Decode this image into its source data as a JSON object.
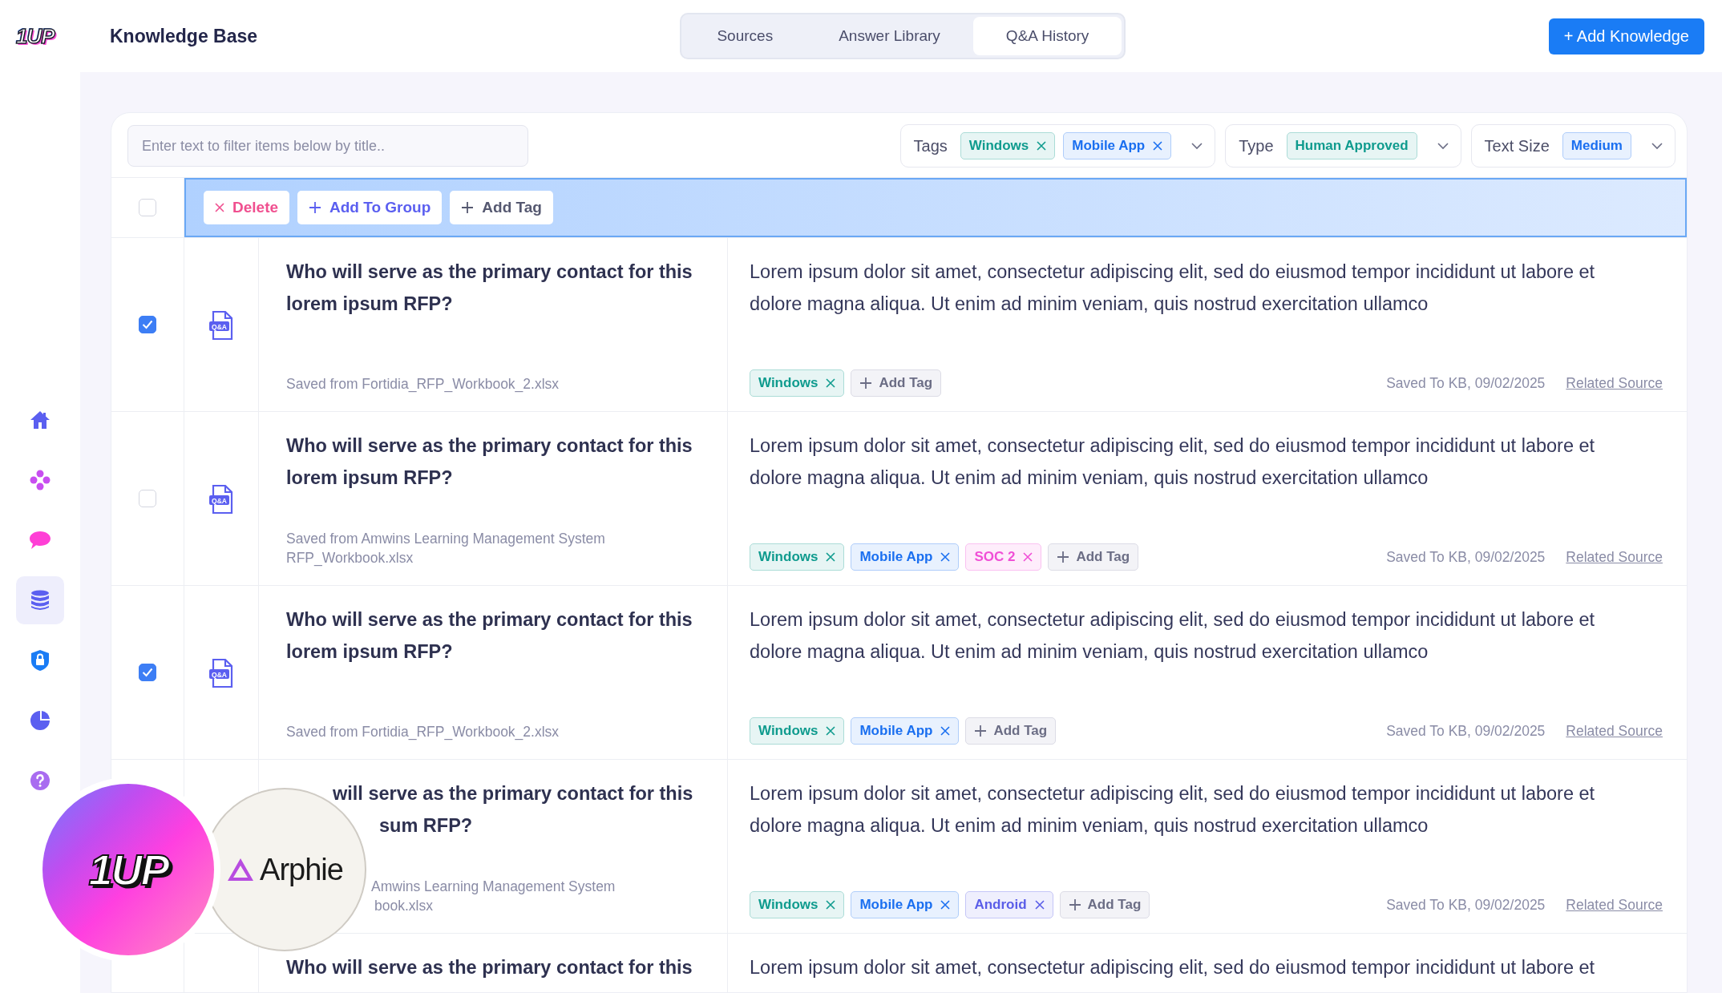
{
  "header": {
    "logo": "1UP",
    "title": "Knowledge Base",
    "tabs": [
      {
        "label": "Sources",
        "selected": false
      },
      {
        "label": "Answer Library",
        "selected": false
      },
      {
        "label": "Q&A History",
        "selected": true
      }
    ],
    "add_button": "+ Add Knowledge"
  },
  "sidebar": {
    "items": [
      {
        "selected": false
      },
      {
        "selected": false
      },
      {
        "selected": false
      },
      {
        "selected": true
      },
      {
        "selected": false
      },
      {
        "selected": false
      },
      {
        "selected": false
      }
    ]
  },
  "filters": {
    "search_placeholder": "Enter text to filter items below by title..",
    "groups": [
      {
        "label": "Tags",
        "chips": [
          {
            "label": "Windows",
            "color": "#0f9b8e"
          },
          {
            "label": "Mobile App",
            "color": "#1a6ff0"
          }
        ]
      },
      {
        "label": "Type",
        "chips": [
          {
            "label": "Human Approved",
            "color": "#0f9b8e"
          }
        ]
      },
      {
        "label": "Text Size",
        "chips": [
          {
            "label": "Medium",
            "color": "#1a6ff0"
          }
        ]
      }
    ]
  },
  "bulk_actions": {
    "all_checked": false,
    "buttons": [
      {
        "kind": "delete",
        "label": "Delete"
      },
      {
        "kind": "group",
        "label": "Add To Group"
      },
      {
        "kind": "tag",
        "label": "Add Tag"
      }
    ]
  },
  "rows": [
    {
      "kind": "full",
      "checked": true,
      "file_badge": "Q&A",
      "question": "Who will serve as the primary contact for this lorem ipsum RFP?",
      "source": "Saved from Fortidia_RFP_Workbook_2.xlsx",
      "answer": "Lorem ipsum dolor sit amet, consectetur adipiscing elit, sed do eiusmod tempor incididunt ut labore et dolore magna aliqua. Ut enim ad minim veniam, quis nostrud exercitation ullamco",
      "tags": [
        {
          "label": "Windows",
          "color": "#0f9b8e"
        }
      ],
      "add_tag": "Add Tag",
      "saved": "Saved To KB, 09/02/2025",
      "link": "Related Source"
    },
    {
      "kind": "full",
      "checked": false,
      "file_badge": "Q&A",
      "question": "Who will serve as the primary contact for this lorem ipsum RFP?",
      "source": "Saved from Amwins Learning Management System RFP_Workbook.xlsx",
      "answer": "Lorem ipsum dolor sit amet, consectetur adipiscing elit, sed do eiusmod tempor incididunt ut labore et dolore magna aliqua. Ut enim ad minim veniam, quis nostrud exercitation ullamco",
      "tags": [
        {
          "label": "Windows",
          "color": "#0f9b8e"
        },
        {
          "label": "Mobile App",
          "color": "#1a6ff0"
        },
        {
          "label": "SOC 2",
          "color": "#f04fd6"
        }
      ],
      "add_tag": "Add Tag",
      "saved": "Saved To KB, 09/02/2025",
      "link": "Related Source"
    },
    {
      "kind": "full",
      "checked": true,
      "file_badge": "Q&A",
      "question": "Who will serve as the primary contact for this lorem ipsum RFP?",
      "source": "Saved from Fortidia_RFP_Workbook_2.xlsx",
      "answer": "Lorem ipsum dolor sit amet, consectetur adipiscing elit, sed do eiusmod tempor incididunt ut labore et dolore magna aliqua. Ut enim ad minim veniam, quis nostrud exercitation ullamco",
      "tags": [
        {
          "label": "Windows",
          "color": "#0f9b8e"
        },
        {
          "label": "Mobile App",
          "color": "#1a6ff0"
        }
      ],
      "add_tag": "Add Tag",
      "saved": "Saved To KB, 09/02/2025",
      "link": "Related Source"
    },
    {
      "kind": "covered",
      "question_lines": [
        "will serve as the primary contact for this",
        "sum RFP?"
      ],
      "source_lines": [
        "Amwins Learning Management System",
        "book.xlsx"
      ],
      "answer": "Lorem ipsum dolor sit amet, consectetur adipiscing elit, sed do eiusmod tempor incididunt ut labore et dolore magna aliqua. Ut enim ad minim veniam, quis nostrud exercitation ullamco",
      "tags": [
        {
          "label": "Windows",
          "color": "#0f9b8e"
        },
        {
          "label": "Mobile App",
          "color": "#1a6ff0"
        },
        {
          "label": "Android",
          "color": "#5a5de8"
        }
      ],
      "add_tag": "Add Tag",
      "saved": "Saved To KB, 09/02/2025",
      "link": "Related Source"
    },
    {
      "kind": "cut",
      "question": "Who will serve as the primary contact for this",
      "answer": "Lorem ipsum dolor sit amet, consectetur adipiscing elit, sed do eiusmod tempor incididunt ut labore et"
    }
  ],
  "overlay_logos": [
    {
      "text": "1UP"
    },
    {
      "text": "Arphie"
    }
  ]
}
